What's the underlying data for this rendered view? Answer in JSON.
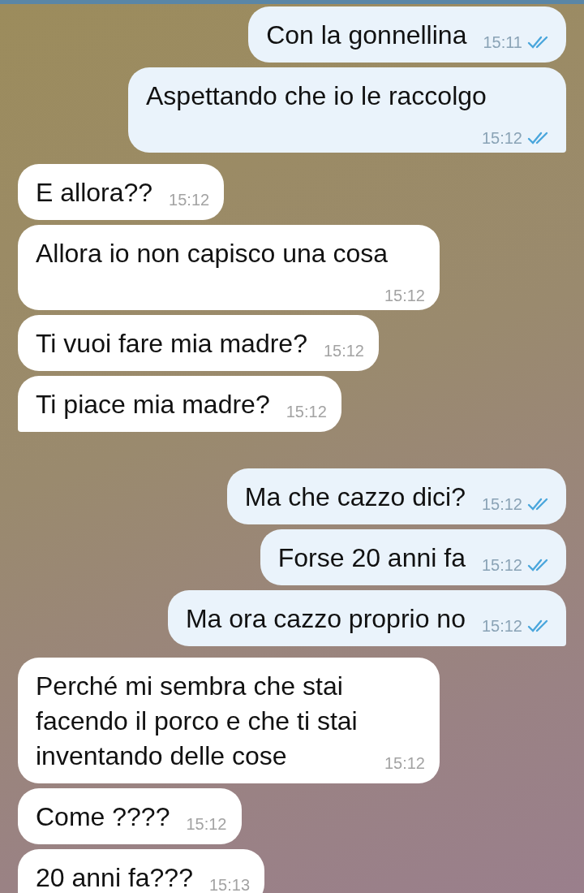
{
  "messages": [
    {
      "kind": "outgoing",
      "text": "Con la gonnellina",
      "time": "15:11",
      "read": true
    },
    {
      "kind": "outgoing",
      "text": "Aspettando che io le raccolgo",
      "time": "15:12",
      "read": true
    },
    {
      "kind": "incoming",
      "text": "E allora??",
      "time": "15:12"
    },
    {
      "kind": "incoming",
      "text": "Allora io non capisco una cosa",
      "time": "15:12"
    },
    {
      "kind": "incoming",
      "text": "Ti vuoi fare mia madre?",
      "time": "15:12"
    },
    {
      "kind": "incoming",
      "text": "Ti piace mia madre?",
      "time": "15:12"
    },
    {
      "kind": "outgoing",
      "text": "Ma che cazzo dici?",
      "time": "15:12",
      "read": true
    },
    {
      "kind": "outgoing",
      "text": "Forse 20 anni fa",
      "time": "15:12",
      "read": true
    },
    {
      "kind": "outgoing",
      "text": "Ma ora cazzo proprio no",
      "time": "15:12",
      "read": true
    },
    {
      "kind": "incoming",
      "text": "Perché mi sembra che stai facendo il porco e che ti stai inventando delle cose",
      "time": "15:12"
    },
    {
      "kind": "incoming",
      "text": "Come ????",
      "time": "15:12"
    },
    {
      "kind": "incoming",
      "text": "20 anni fa???",
      "time": "15:13"
    }
  ]
}
